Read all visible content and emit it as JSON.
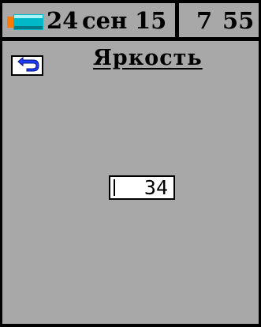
{
  "status": {
    "date_day": "24",
    "date_month": "сен",
    "date_year": "15",
    "time_hour": "7",
    "time_minute": "55",
    "battery_color": "#00b8c8",
    "battery_tip_color": "#ff7a00"
  },
  "header": {
    "back_icon": "back-arrow-icon",
    "title": "Яркость"
  },
  "main": {
    "brightness_value": "34"
  }
}
